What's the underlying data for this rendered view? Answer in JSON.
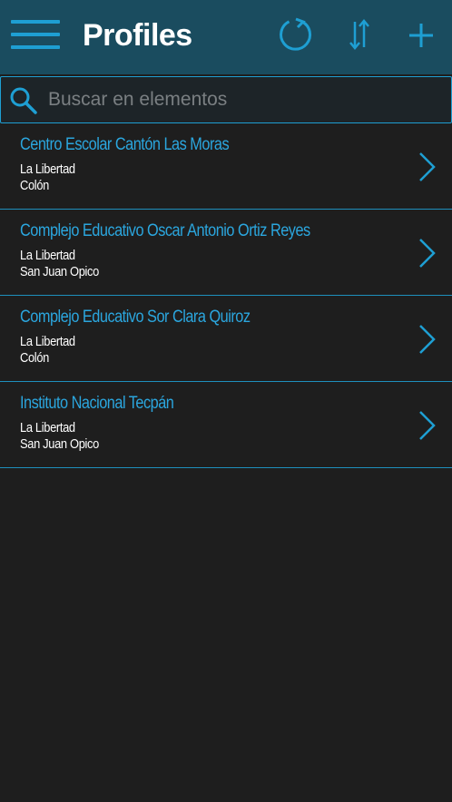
{
  "header": {
    "title": "Profiles",
    "menu_icon": "hamburger-menu-icon",
    "actions": [
      "refresh-icon",
      "sort-icon",
      "add-icon"
    ]
  },
  "search": {
    "placeholder": "Buscar en elementos",
    "value": ""
  },
  "items": [
    {
      "title": "Centro Escolar Cantón Las Moras",
      "line1": "La Libertad",
      "line2": "Colón"
    },
    {
      "title": "Complejo Educativo Oscar Antonio Ortiz Reyes",
      "line1": "La Libertad",
      "line2": "San Juan Opico"
    },
    {
      "title": "Complejo Educativo Sor Clara Quiroz",
      "line1": "La Libertad",
      "line2": "Colón"
    },
    {
      "title": "Instituto Nacional Tecpán",
      "line1": "La Libertad",
      "line2": "San Juan Opico"
    }
  ],
  "colors": {
    "header_bg": "#1a4c5f",
    "accent": "#1e9fd3",
    "page_bg": "#1e1e1e",
    "title_text": "#2ba6de"
  }
}
